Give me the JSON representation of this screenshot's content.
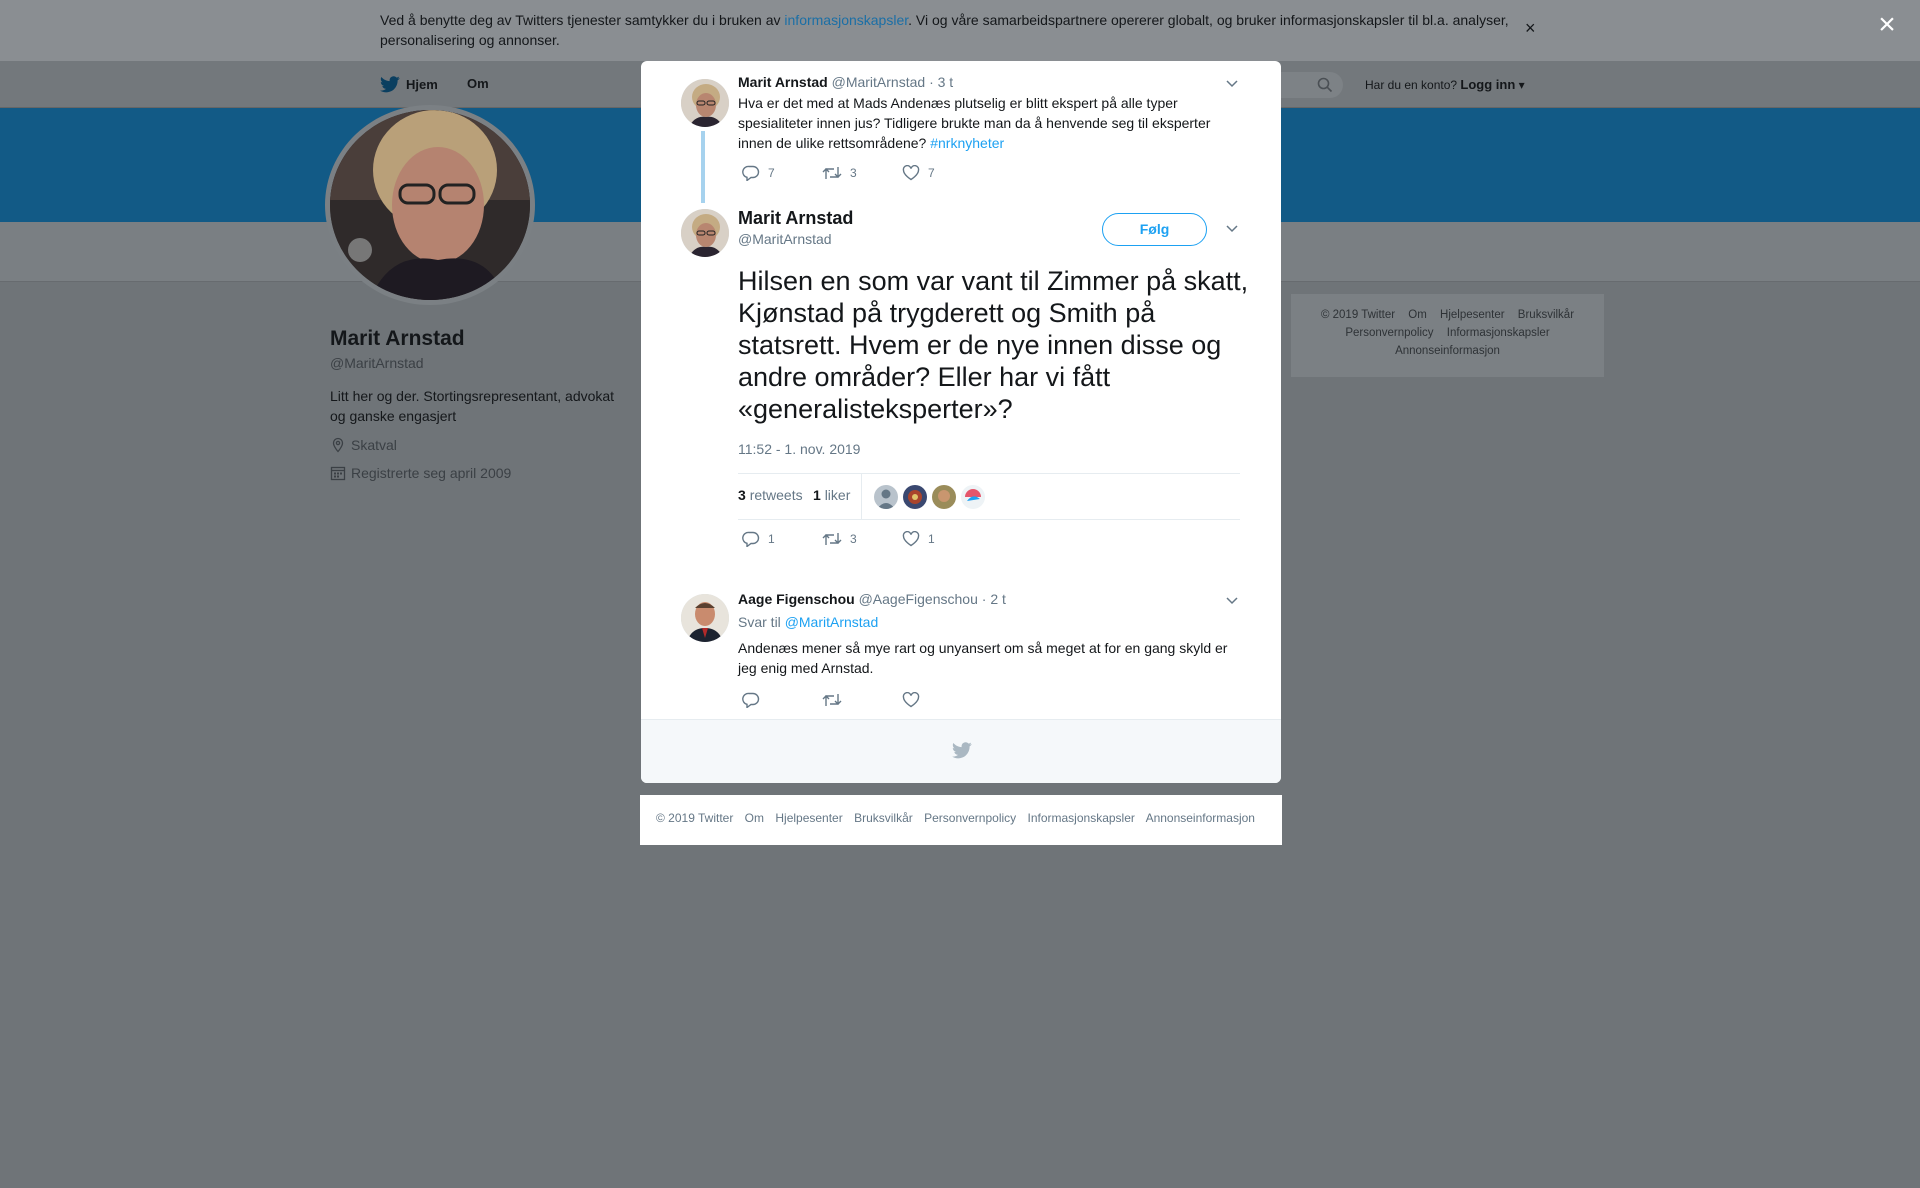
{
  "cookie": {
    "text_before": "Ved å benytte deg av Twitters tjenester samtykker du i bruken av ",
    "link": "informasjonskapsler",
    "text_after": ". Vi og våre samarbeidspartnere opererer globalt, og bruker informasjonskapsler til bl.a. analyser, personalisering og annonser.",
    "close": "×"
  },
  "nav": {
    "home": "Hjem",
    "about": "Om",
    "account_prompt": "Har du en konto?",
    "login": "Logg inn"
  },
  "profile": {
    "name": "Marit Arnstad",
    "handle": "@MaritArnstad",
    "bio": "Litt her og der. Stortingsrepresentant, advokat og ganske engasjert",
    "location": "Skatval",
    "joined": "Registrerte seg april 2009"
  },
  "side_footer": {
    "items": [
      "© 2019 Twitter",
      "Om",
      "Hjelpesenter",
      "Bruksvilkår",
      "Personvernpolicy",
      "Informasjonskapsler",
      "Annonseinformasjon"
    ]
  },
  "overlay_close": "×",
  "tweet_parent": {
    "name": "Marit Arnstad",
    "handle": "@MaritArnstad",
    "time": "· 3 t",
    "text": "Hva er det med at Mads Andenæs plutselig er blitt ekspert på alle typer spesialiteter innen jus? Tidligere brukte man da å henvende seg til eksperter innen de ulike rettsområdene? ",
    "hashtag": "#nrknyheter",
    "replies": "7",
    "retweets": "3",
    "likes": "7"
  },
  "tweet_main": {
    "name": "Marit Arnstad",
    "handle": "@MaritArnstad",
    "follow": "Følg",
    "text": "Hilsen en som var vant til Zimmer på skatt, Kjønstad på trygderett og Smith på statsrett. Hvem er de nye innen disse og andre områder? Eller har vi fått «generalisteksperter»?",
    "timestamp": "11:52 - 1. nov. 2019",
    "retweet_count": "3",
    "retweet_label": "retweets",
    "like_count": "1",
    "like_label": "liker",
    "replies": "1",
    "retweets": "3",
    "likes": "1"
  },
  "tweet_reply": {
    "name": "Aage Figenschou",
    "handle": "@AageFigenschou",
    "time": "· 2 t",
    "reply_to_label": "Svar til",
    "reply_to_handle": "@MaritArnstad",
    "text": "Andenæs mener så mye rart og unyansert om så meget at for en gang skyld er jeg enig med Arnstad."
  },
  "bottom_footer": {
    "items": [
      "© 2019 Twitter",
      "Om",
      "Hjelpesenter",
      "Bruksvilkår",
      "Personvernpolicy",
      "Informasjonskapsler",
      "Annonseinformasjon"
    ]
  }
}
